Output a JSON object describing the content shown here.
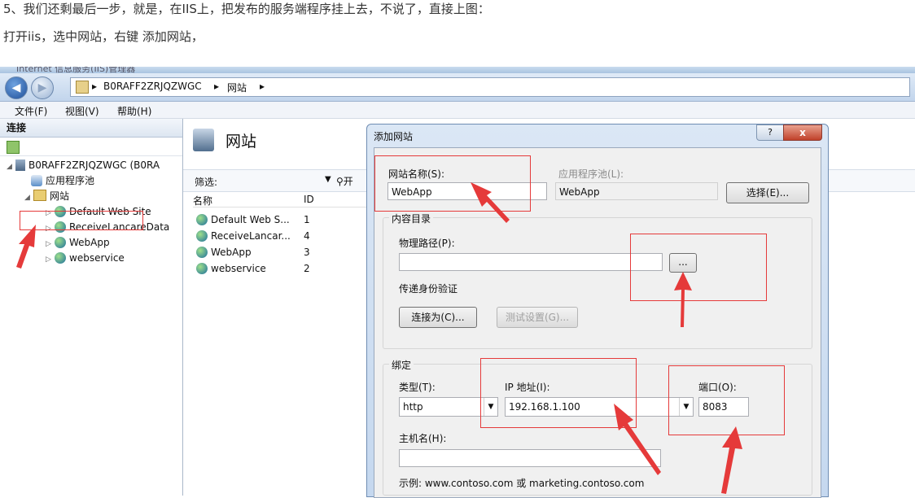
{
  "intro": {
    "line1": "5、我们还剩最后一步，就是，在IIS上，把发布的服务端程序挂上去，不说了，直接上图：",
    "line2": "打开iis，选中网站，右键 添加网站，"
  },
  "window": {
    "title_partial": "Internet 信息服务(IIS)管理器",
    "breadcrumb": [
      "B0RAFF2ZRJQZWGC",
      "网站"
    ],
    "menu": [
      "文件(F)",
      "视图(V)",
      "帮助(H)"
    ]
  },
  "left_pane": {
    "header": "连接",
    "tree": {
      "server": "B0RAFF2ZRJQZWGC (B0RA",
      "app_pools": "应用程序池",
      "sites": "网站",
      "site_list": [
        "Default Web Site",
        "ReceiveLancareData",
        "WebApp",
        "webservice"
      ]
    }
  },
  "content": {
    "title": "网站",
    "filter_label": "筛选:",
    "go_label": "开",
    "col_name": "名称",
    "col_id": "ID",
    "rows": [
      {
        "name": "Default Web S...",
        "id": "1"
      },
      {
        "name": "ReceiveLancar...",
        "id": "4"
      },
      {
        "name": "WebApp",
        "id": "3"
      },
      {
        "name": "webservice",
        "id": "2"
      }
    ]
  },
  "dialog": {
    "title": "添加网站",
    "help": "?",
    "close": "x",
    "site_name_label": "网站名称(S):",
    "site_name_value": "WebApp",
    "app_pool_label": "应用程序池(L):",
    "app_pool_value": "WebApp",
    "select_button": "选择(E)...",
    "content_dir": "内容目录",
    "physical_path_label": "物理路径(P):",
    "physical_path_value": "",
    "browse_button": "...",
    "pass_auth": "传递身份验证",
    "connect_as": "连接为(C)...",
    "test_settings": "测试设置(G)...",
    "binding": "绑定",
    "type_label": "类型(T):",
    "type_value": "http",
    "ip_label": "IP 地址(I):",
    "ip_value": "192.168.1.100",
    "port_label": "端口(O):",
    "port_value": "8083",
    "host_label": "主机名(H):",
    "host_value": "",
    "example": "示例: www.contoso.com 或 marketing.contoso.com"
  },
  "colors": {
    "annotation_red": "#e53a3a",
    "accent_blue": "#1f4f99"
  }
}
